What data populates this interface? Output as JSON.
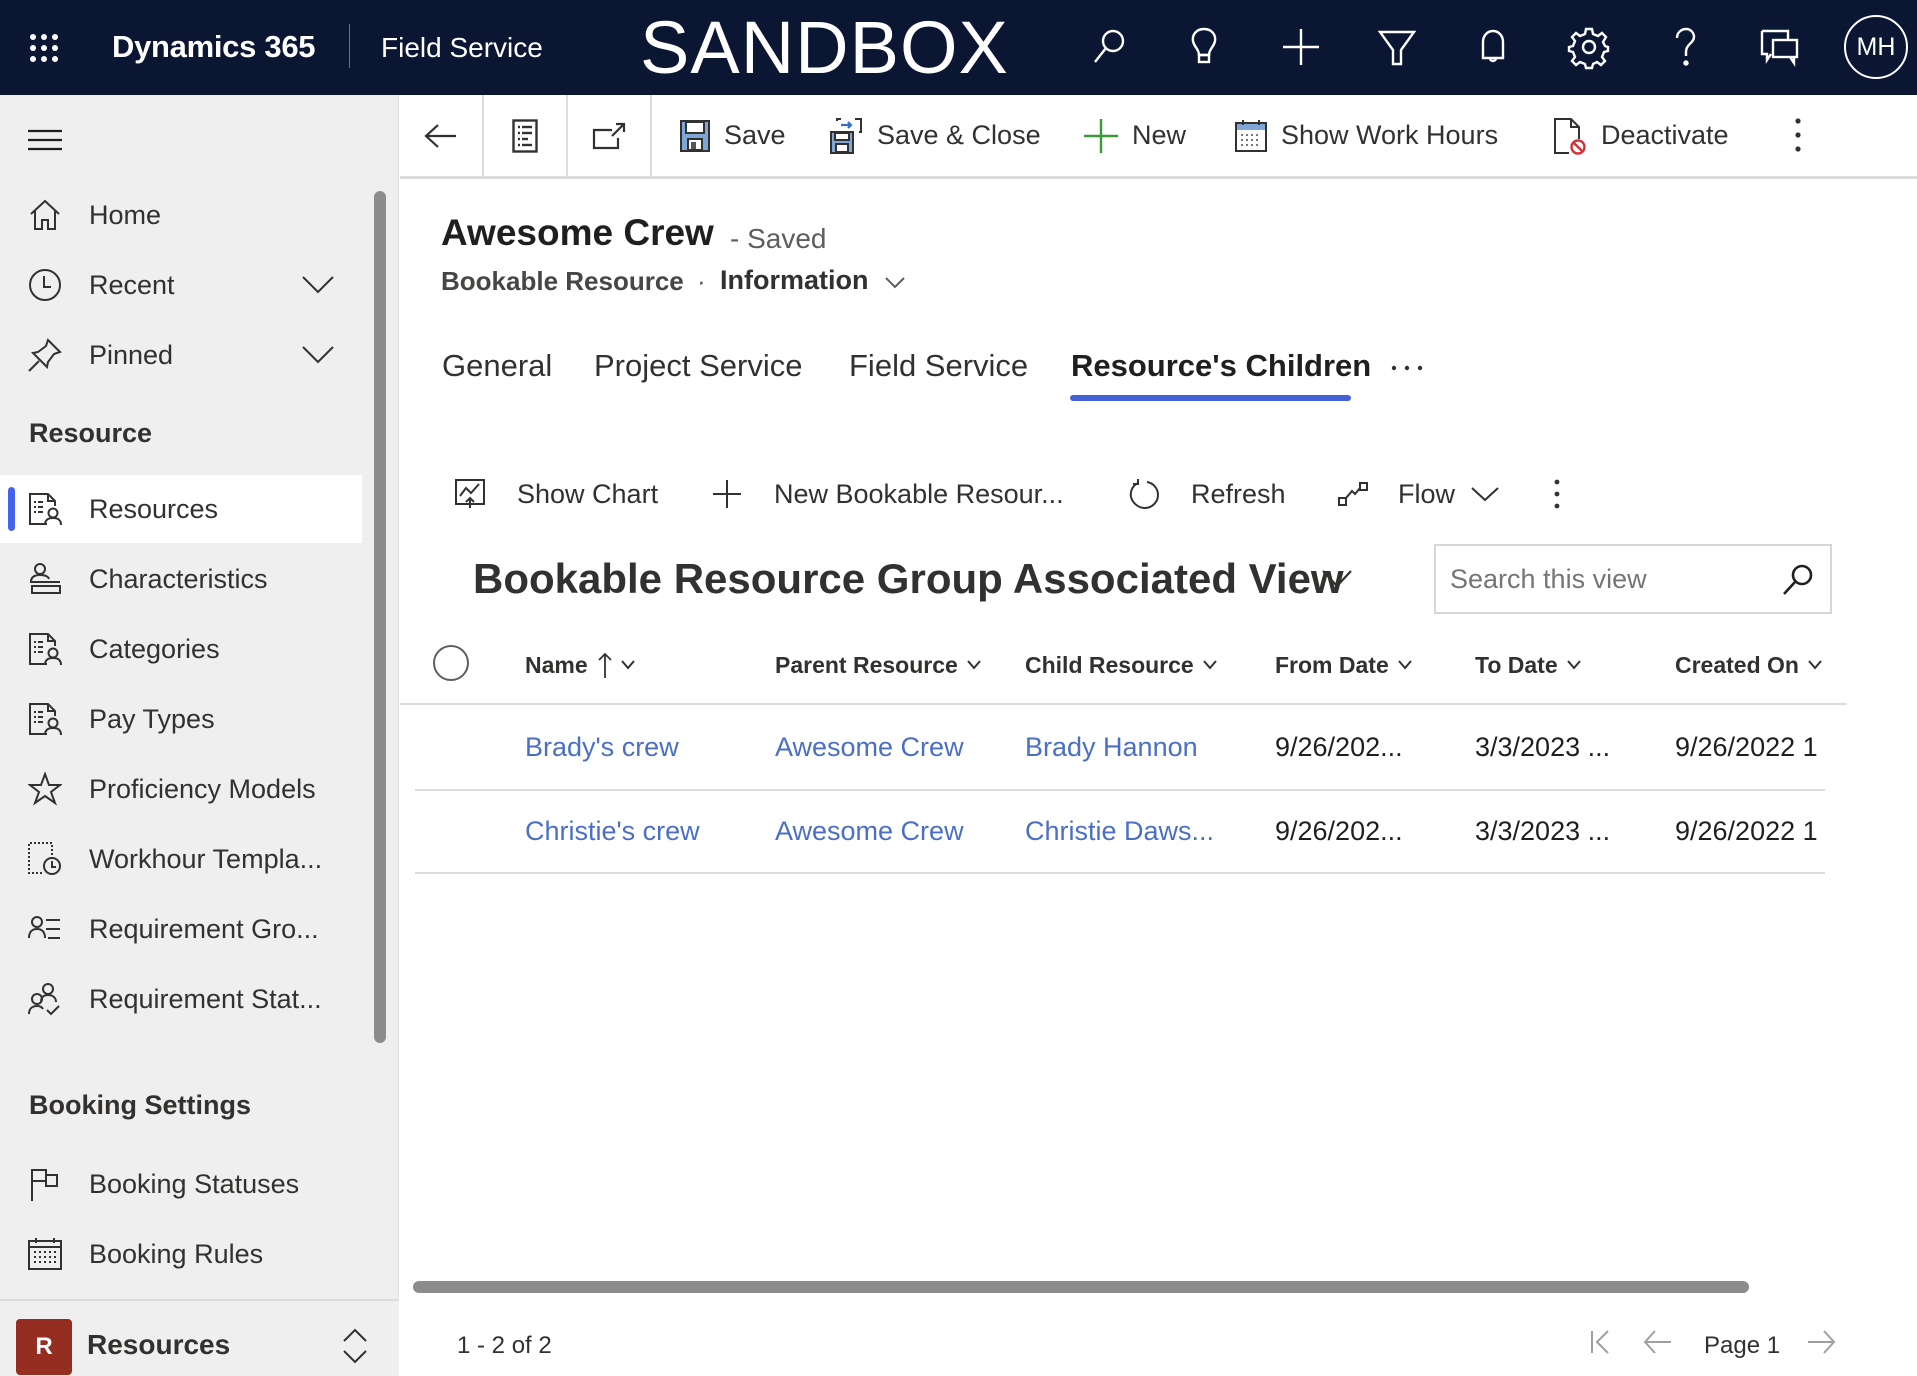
{
  "topbar": {
    "brand": "Dynamics 365",
    "app_name": "Field Service",
    "environment": "SANDBOX",
    "icons": [
      "search-icon",
      "lightbulb-icon",
      "plus-icon",
      "filter-icon",
      "bell-icon",
      "gear-icon",
      "help-icon",
      "chat-icon"
    ],
    "avatar_initials": "MH"
  },
  "sidebar": {
    "top_items": [
      {
        "label": "Home",
        "icon": "home-icon"
      },
      {
        "label": "Recent",
        "icon": "clock-icon",
        "expandable": true
      },
      {
        "label": "Pinned",
        "icon": "pin-icon",
        "expandable": true
      }
    ],
    "sections": [
      {
        "title": "Resource",
        "items": [
          {
            "label": "Resources",
            "icon": "resource-doc-icon",
            "active": true
          },
          {
            "label": "Characteristics",
            "icon": "characteristic-icon"
          },
          {
            "label": "Categories",
            "icon": "resource-doc-icon"
          },
          {
            "label": "Pay Types",
            "icon": "resource-doc-icon"
          },
          {
            "label": "Proficiency Models",
            "icon": "star-icon"
          },
          {
            "label": "Workhour Templa...",
            "icon": "workhour-template-icon"
          },
          {
            "label": "Requirement Gro...",
            "icon": "person-list-icon"
          },
          {
            "label": "Requirement Stat...",
            "icon": "people-check-icon"
          }
        ]
      },
      {
        "title": "Booking Settings",
        "items": [
          {
            "label": "Booking Statuses",
            "icon": "flag-icon"
          },
          {
            "label": "Booking Rules",
            "icon": "calendar-icon"
          }
        ]
      }
    ],
    "area": {
      "badge": "R",
      "label": "Resources",
      "badge_color": "#952d21"
    }
  },
  "command_bar": {
    "save": "Save",
    "save_close": "Save & Close",
    "new": "New",
    "show_work_hours": "Show Work Hours",
    "deactivate": "Deactivate"
  },
  "record": {
    "title": "Awesome Crew",
    "status": "- Saved",
    "entity": "Bookable Resource",
    "separator": "·",
    "form": "Information"
  },
  "tabs": [
    {
      "label": "General",
      "active": false
    },
    {
      "label": "Project Service",
      "active": false
    },
    {
      "label": "Field Service",
      "active": false
    },
    {
      "label": "Resource's Children",
      "active": true
    }
  ],
  "subgrid": {
    "commands": {
      "show_chart": "Show Chart",
      "new_record": "New Bookable Resour...",
      "refresh": "Refresh",
      "flow": "Flow"
    },
    "view_name": "Bookable Resource Group Associated View",
    "search_placeholder": "Search this view",
    "columns": [
      "Name",
      "Parent Resource",
      "Child Resource",
      "From Date",
      "To Date",
      "Created On"
    ],
    "sorted_column": "Name",
    "sort_direction": "ascending",
    "rows": [
      {
        "name": "Brady's crew",
        "parent": "Awesome Crew",
        "child": "Brady Hannon",
        "from": "9/26/202...",
        "to": "3/3/2023 ...",
        "created": "9/26/2022 1"
      },
      {
        "name": "Christie's crew",
        "parent": "Awesome Crew",
        "child": "Christie Daws...",
        "from": "9/26/202...",
        "to": "3/3/2023 ...",
        "created": "9/26/2022 1"
      }
    ],
    "record_count": "1 - 2 of 2",
    "page_label": "Page 1"
  },
  "colors": {
    "topbar_bg": "#0b1633",
    "accent": "#4462d6",
    "link": "#4a6fc4",
    "new_green": "#3a9a3a",
    "deactivate_red": "#d13438"
  }
}
